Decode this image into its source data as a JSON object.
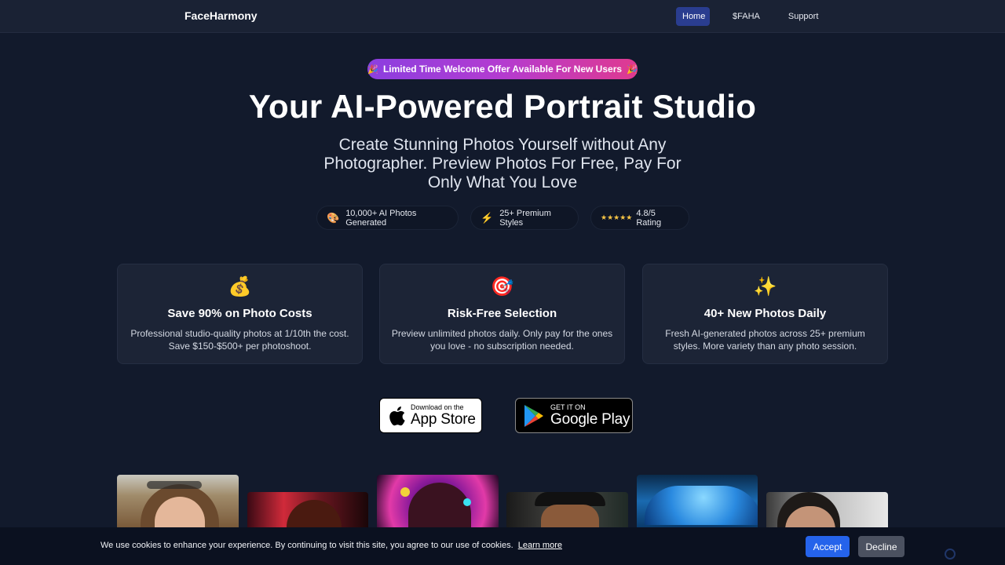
{
  "nav": {
    "brand": "FaceHarmony",
    "links": [
      "Home",
      "$FAHA",
      "Support"
    ],
    "active": "Home"
  },
  "hero": {
    "promo": "Limited Time Welcome Offer Available For New Users",
    "promo_icon": "party-popper-icon",
    "title": "Your AI-Powered Portrait Studio",
    "subtitle": "Create Stunning Photos Yourself without Any Photographer. Preview Photos For Free, Pay For Only What You Love"
  },
  "stats": [
    {
      "icon": "palette-icon",
      "glyph": "🎨",
      "label": "10,000+ AI Photos Generated"
    },
    {
      "icon": "lightning-icon",
      "glyph": "⚡",
      "label": "25+ Premium Styles"
    },
    {
      "icon": "stars-icon",
      "glyph": "★★★★★",
      "label": "4.8/5 Rating"
    }
  ],
  "features": [
    {
      "icon": "money-bag-icon",
      "glyph": "💰",
      "title": "Save 90% on Photo Costs",
      "desc": "Professional studio-quality photos at 1/10th the cost. Save $150-$500+ per photoshoot."
    },
    {
      "icon": "target-icon",
      "glyph": "🎯",
      "title": "Risk-Free Selection",
      "desc": "Preview unlimited photos daily. Only pay for the ones you love - no subscription needed."
    },
    {
      "icon": "sparkles-icon",
      "glyph": "✨",
      "title": "40+ New Photos Daily",
      "desc": "Fresh AI-generated photos across 25+ premium styles. More variety than any photo session."
    }
  ],
  "stores": {
    "apple": {
      "small": "Download on the",
      "big": "App Store"
    },
    "google": {
      "small": "GET IT ON",
      "big": "Google Play"
    }
  },
  "cookie": {
    "text": "We use cookies to enhance your experience. By continuing to visit this site, you agree to our use of cookies.",
    "link": "Learn more",
    "accept": "Accept",
    "decline": "Decline"
  },
  "colors": {
    "background": "#121a2c",
    "accent": "#2563eb",
    "nav_active": "#2a3d8f",
    "promo_gradient": [
      "#8b3fe0",
      "#e03a8f"
    ]
  }
}
